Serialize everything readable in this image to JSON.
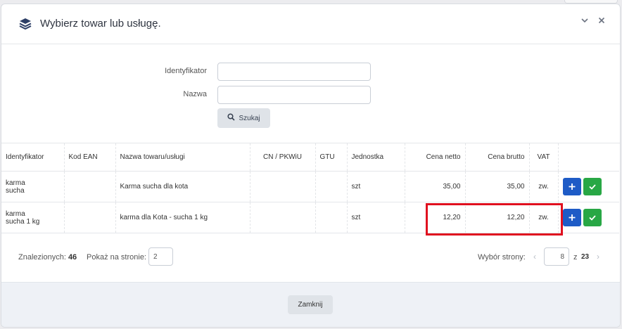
{
  "dialog": {
    "title": "Wybierz towar lub usługę.",
    "icon": "layers-icon",
    "collapse_icon": "chevron-down-icon",
    "close_icon": "close-icon"
  },
  "search": {
    "id_label": "Identyfikator",
    "id_value": "",
    "name_label": "Nazwa",
    "name_value": "",
    "button_label": "Szukaj",
    "button_icon": "search-icon"
  },
  "table": {
    "columns": [
      "Identyfikator",
      "Kod EAN",
      "Nazwa towaru/usługi",
      "CN / PKWiU",
      "GTU",
      "Jednostka",
      "Cena netto",
      "Cena brutto",
      "VAT"
    ],
    "rows": [
      {
        "id_line1": "karma",
        "id_line2": "sucha",
        "ean": "",
        "name": "Karma sucha dla kota",
        "cn": "",
        "gtu": "",
        "unit": "szt",
        "netto": "35,00",
        "brutto": "35,00",
        "vat": "zw."
      },
      {
        "id_line1": "karma",
        "id_line2": "sucha 1 kg",
        "ean": "",
        "name": "karma dla Kota - sucha 1 kg",
        "cn": "",
        "gtu": "",
        "unit": "szt",
        "netto": "12,20",
        "brutto": "12,20",
        "vat": "zw."
      }
    ]
  },
  "footer": {
    "found_label": "Znalezionych:",
    "found_count": "46",
    "perpage_label": "Pokaż na stronie:",
    "perpage_value": "2",
    "pager_label": "Wybór strony:",
    "page_value": "8",
    "of_label": "z",
    "total_pages": "23"
  },
  "close_button": "Zamknij",
  "colors": {
    "accent_blue": "#1e5bc6",
    "accept_green": "#28a745",
    "highlight_red": "#e0101f"
  }
}
